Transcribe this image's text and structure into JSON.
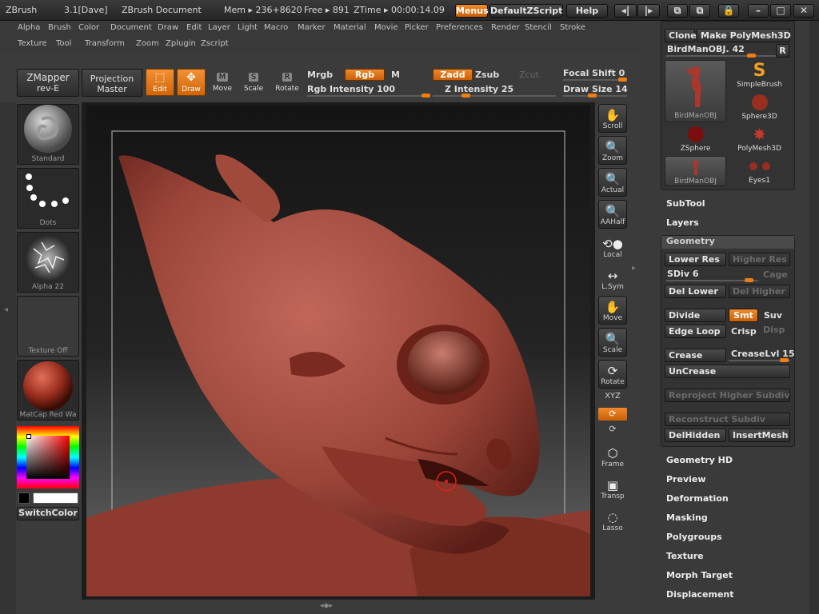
{
  "titlebar": {
    "app": "ZBrush",
    "version": "3.1[Dave]",
    "document": "ZBrush Document",
    "mem": "Mem ▸ 236+8620",
    "free": "Free ▸ 891",
    "ztime": "ZTime ▸ 00:00:14.09",
    "menus_btn": "Menus",
    "script_btn": "DefaultZScript",
    "help_btn": "Help"
  },
  "menus": {
    "row1": [
      "Alpha",
      "Brush",
      "Color",
      "Document",
      "Draw",
      "Edit",
      "Layer",
      "Light",
      "Macro",
      "Marker",
      "Material",
      "Movie",
      "Picker",
      "Preferences",
      "Render",
      "Stencil",
      "Stroke"
    ],
    "row2": [
      "Texture",
      "Tool",
      "Transform",
      "Zoom",
      "Zplugin",
      "Zscript"
    ]
  },
  "shelf": {
    "zmapper": "ZMapper",
    "zmapper_sub": "rev-E",
    "projection": "Projection",
    "projection_sub": "Master",
    "edit": "Edit",
    "draw": "Draw",
    "move": "Move",
    "scale": "Scale",
    "rotate": "Rotate",
    "mrgb": "Mrgb",
    "rgb": "Rgb",
    "m": "M",
    "rgb_intensity": "Rgb Intensity 100",
    "rgb_intensity_value": 1.0,
    "zadd": "Zadd",
    "zsub": "Zsub",
    "zcut": "Zcut",
    "z_intensity": "Z Intensity 25",
    "z_intensity_value": 0.25,
    "focal_shift": "Focal Shift 0",
    "draw_size": "Draw Size 14"
  },
  "left_tray": {
    "brush": "Standard",
    "stroke": "Dots",
    "alpha": "Alpha 22",
    "texture": "Texture Off",
    "material": "MatCap Red Wa",
    "switch_color": "SwitchColor",
    "transp_label": "Transp"
  },
  "right_strip": {
    "scroll": "Scroll",
    "zoom": "Zoom",
    "actual": "Actual",
    "aahalf": "AAHalf",
    "local": "Local",
    "lsym": "L.Sym",
    "move": "Move",
    "scale": "Scale",
    "rotate": "Rotate",
    "xyz": "XYZ",
    "frame": "Frame",
    "transp": "Transp",
    "lasso": "Lasso"
  },
  "tool_panel": {
    "clone": "Clone",
    "make_polymesh": "Make PolyMesh3D",
    "current_tool": "BirdManOBJ. 42",
    "r_btn": "R",
    "tools": [
      "BirdManOBJ",
      "SimpleBrush",
      "Sphere3D",
      "ZSphere",
      "PolyMesh3D",
      "BirdManOBJ",
      "Eyes1"
    ],
    "subtool": "SubTool",
    "layers": "Layers",
    "geometry": "Geometry",
    "lower_res": "Lower Res",
    "higher_res": "Higher Res",
    "sdiv": "SDiv 6",
    "cage": "Cage",
    "del_lower": "Del Lower",
    "del_higher": "Del Higher",
    "divide": "Divide",
    "smt": "Smt",
    "suv": "Suv",
    "edge_loop": "Edge Loop",
    "crisp": "Crisp",
    "disp": "Disp",
    "crease": "Crease",
    "crease_lvl": "CreaseLvl 15",
    "uncrease": "UnCrease",
    "reproject": "Reproject Higher Subdiv",
    "reconstruct": "Reconstruct Subdiv",
    "del_hidden": "DelHidden",
    "insert_mesh": "InsertMesh",
    "sections": [
      "Geometry HD",
      "Preview",
      "Deformation",
      "Masking",
      "Polygroups",
      "Texture",
      "Morph Target",
      "Displacement"
    ]
  }
}
